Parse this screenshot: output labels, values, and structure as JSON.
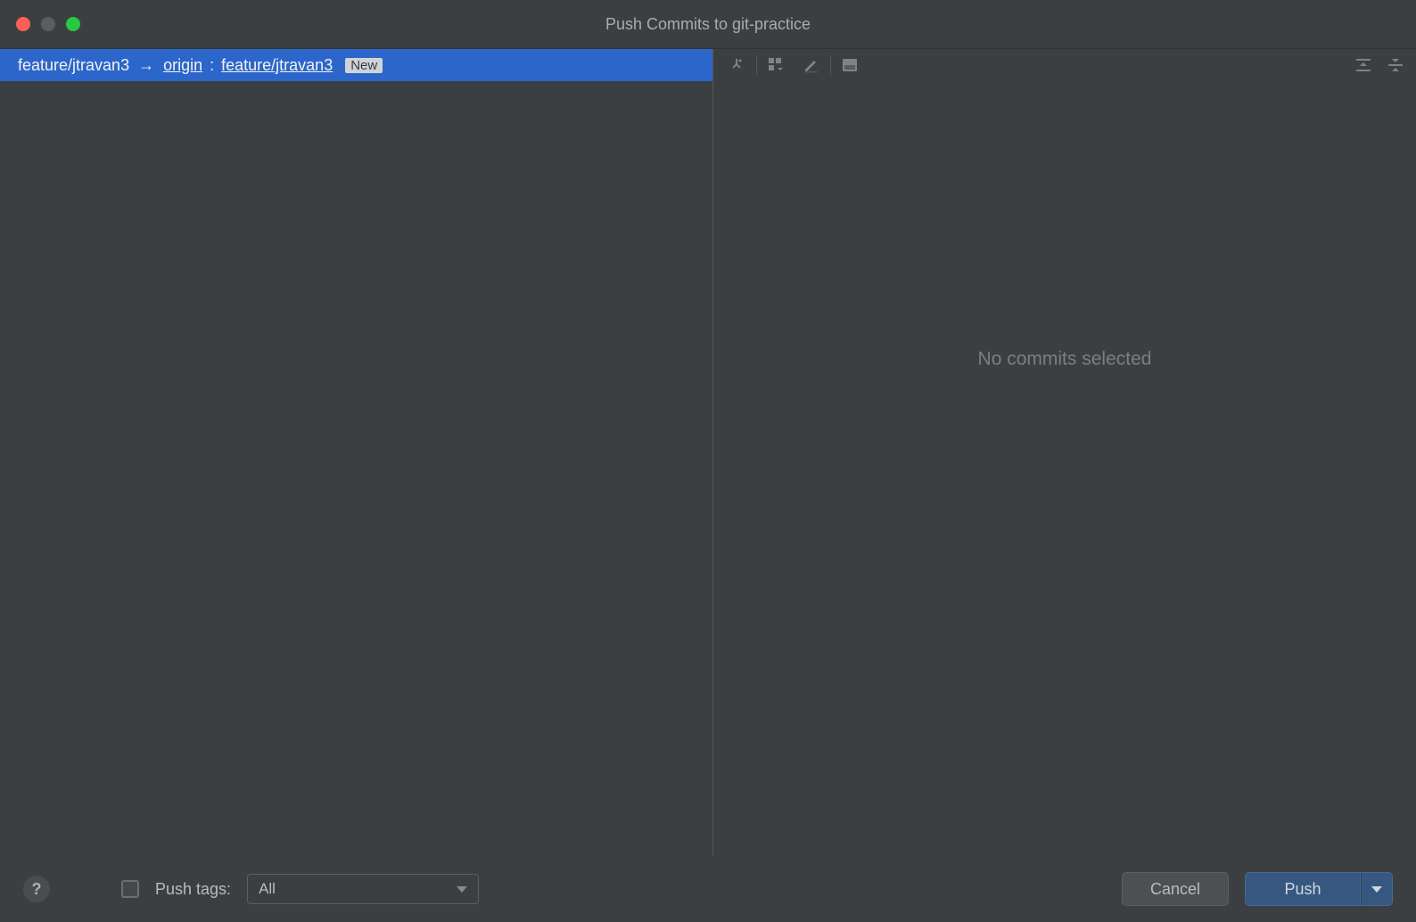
{
  "title": "Push Commits to git-practice",
  "branch_row": {
    "local_branch": "feature/jtravan3",
    "arrow_glyph": "→",
    "remote_name": "origin",
    "colon": " : ",
    "remote_branch": "feature/jtravan3",
    "badge": "New"
  },
  "right_pane": {
    "empty_message": "No commits selected"
  },
  "footer": {
    "help_glyph": "?",
    "push_tags_label": "Push tags:",
    "push_tags_selected": "All",
    "cancel_label": "Cancel",
    "push_label": "Push"
  }
}
